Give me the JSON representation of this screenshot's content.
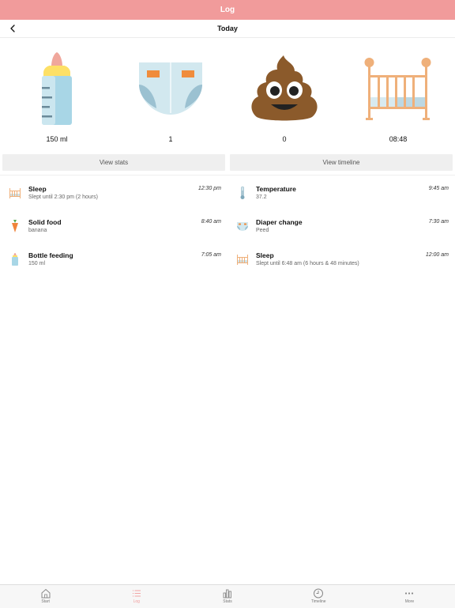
{
  "header": {
    "title": "Log"
  },
  "nav": {
    "title": "Today"
  },
  "summary": [
    {
      "icon": "baby-bottle-icon",
      "value": "150 ml"
    },
    {
      "icon": "diaper-icon",
      "value": "1"
    },
    {
      "icon": "poop-icon",
      "value": "0"
    },
    {
      "icon": "crib-icon",
      "value": "08:48"
    }
  ],
  "buttons": {
    "view_stats": "View stats",
    "view_timeline": "View timeline"
  },
  "entries_left": [
    {
      "icon": "crib-icon",
      "title": "Sleep",
      "detail": "Slept until 2:30 pm (2 hours)",
      "time": "12:30 pm"
    },
    {
      "icon": "carrot-icon",
      "title": "Solid food",
      "detail": "banana",
      "time": "8:40 am"
    },
    {
      "icon": "baby-bottle-icon",
      "title": "Bottle feeding",
      "detail": "150 ml",
      "time": "7:05 am"
    }
  ],
  "entries_right": [
    {
      "icon": "thermometer-icon",
      "title": "Temperature",
      "detail": "37.2",
      "time": "9:45 am"
    },
    {
      "icon": "diaper-icon",
      "title": "Diaper change",
      "detail": "Peed",
      "time": "7:30 am"
    },
    {
      "icon": "crib-icon",
      "title": "Sleep",
      "detail": "Slept until 6:48 am (6 hours & 48 minutes)",
      "time": "12:00 am"
    }
  ],
  "tabs": [
    {
      "icon": "house-icon",
      "label": "Start"
    },
    {
      "icon": "list-icon",
      "label": "Log"
    },
    {
      "icon": "bar-chart-icon",
      "label": "Stats"
    },
    {
      "icon": "clock-icon",
      "label": "Timeline"
    },
    {
      "icon": "more-dots-icon",
      "label": "More"
    }
  ],
  "colors": {
    "brand": "#f19b9b",
    "button_bg": "#efefef",
    "tabbar_bg": "#f7f7f7"
  }
}
